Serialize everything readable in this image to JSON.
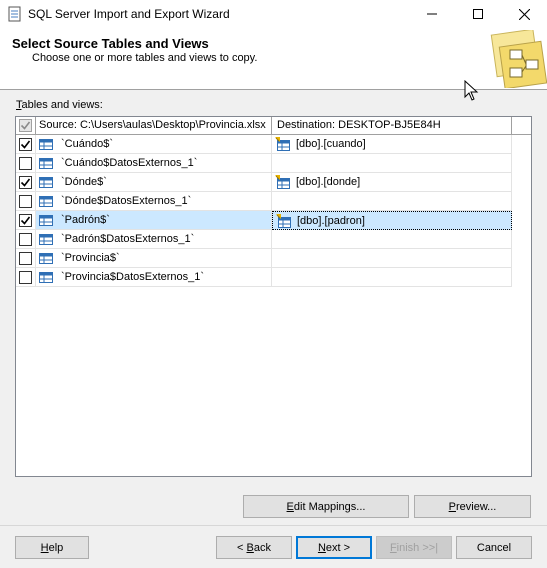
{
  "window": {
    "title": "SQL Server Import and Export Wizard",
    "minimize_glyph": "—",
    "maximize_glyph": "☐",
    "close_glyph": "✕"
  },
  "header": {
    "title": "Select Source Tables and Views",
    "subtitle": "Choose one or more tables and views to copy."
  },
  "grid": {
    "label_first": "T",
    "label_rest": "ables and views:",
    "col_source": "Source: C:\\Users\\aulas\\Desktop\\Provincia.xlsx",
    "col_destination": "Destination: DESKTOP-BJ5E84H",
    "rows": [
      {
        "checked": true,
        "source": "`Cuándo$`",
        "destination": "[dbo].[cuando]"
      },
      {
        "checked": false,
        "source": "`Cuándo$DatosExternos_1`",
        "destination": ""
      },
      {
        "checked": true,
        "source": "`Dónde$`",
        "destination": "[dbo].[donde]"
      },
      {
        "checked": false,
        "source": "`Dónde$DatosExternos_1`",
        "destination": ""
      },
      {
        "checked": true,
        "source": "`Padrón$`",
        "destination": "[dbo].[padron]",
        "selected": true
      },
      {
        "checked": false,
        "source": "`Padrón$DatosExternos_1`",
        "destination": ""
      },
      {
        "checked": false,
        "source": "`Provincia$`",
        "destination": ""
      },
      {
        "checked": false,
        "source": "`Provincia$DatosExternos_1`",
        "destination": ""
      }
    ]
  },
  "buttons": {
    "edit_mappings": {
      "ul": "E",
      "rest": "dit Mappings..."
    },
    "preview": {
      "ul": "P",
      "rest": "review..."
    },
    "help": {
      "ul": "H",
      "rest": "elp"
    },
    "back": {
      "pre": "< ",
      "ul": "B",
      "rest": "ack"
    },
    "next": {
      "ul": "N",
      "rest": "ext >"
    },
    "finish": {
      "ul": "F",
      "rest": "inish >>|"
    },
    "cancel": "Cancel"
  },
  "colors": {
    "selected_row": "#cce8ff",
    "default_button_border": "#0078d7",
    "table_icon_blue": "#2f6fb5"
  }
}
